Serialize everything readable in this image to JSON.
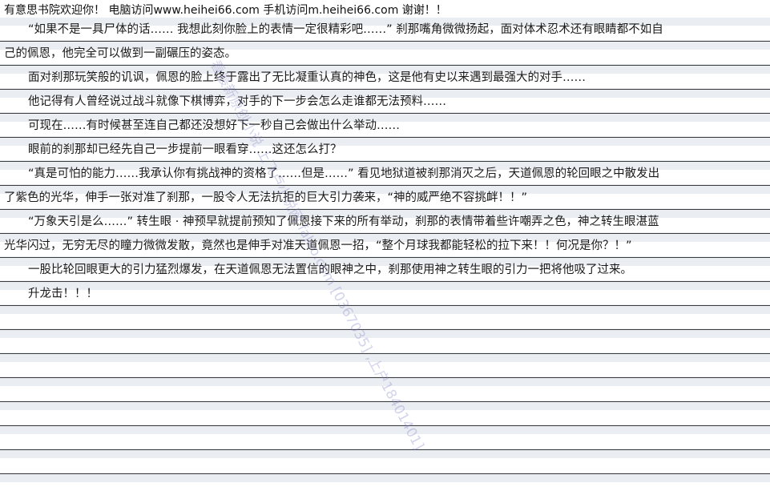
{
  "header": {
    "text": "有意思书院欢迎你！ 电脑访问www.heihei66.com  手机访问m.heihei66.com 谢谢！！"
  },
  "watermark": "看最新原创小说 上飞卢小说网 faloo.com [0367035] ,上户18401401]",
  "lines": [
    "“如果不是一具尸体的话…… 我想此刻你脸上的表情一定很精彩吧……” 刹那嘴角微微扬起，面对体术忍术还有眼睛都不如自",
    "己的佩恩，他完全可以做到一副碾压的姿态。",
    "",
    "面对刹那玩笑般的讥讽，佩恩的脸上终于露出了无比凝重认真的神色，这是他有史以来遇到最强大的对手……",
    "",
    "他记得有人曾经说过战斗就像下棋博弈，对手的下一步会怎么走谁都无法预料……",
    "",
    "可现在……有时候甚至连自己都还没想好下一秒自己会做出什么举动……",
    "",
    "眼前的刹那却已经先自己一步提前一眼看穿……这还怎么打？",
    "",
    "“真是可怕的能力……我承认你有挑战神的资格了……但是……” 看见地狱道被刹那消灭之后，天道佩恩的轮回眼之中散发出",
    "了紫色的光华，伸手一张对准了刹那，一股令人无法抗拒的巨大引力袭来，“神的威严绝不容挑衅！！”",
    "",
    "“万象天引是么……” 转生眼 · 神预早就提前预知了佩恩接下来的所有举动，刹那的表情带着些许嘲弄之色，神之转生眼湛蓝",
    "光华闪过，无穷无尽的瞳力微微发散，竟然也是伸手对准天道佩恩一招，“整个月球我都能轻松的拉下来！！何况是你？！”",
    "",
    "一股比轮回眼更大的引力猛烈爆发，在天道佩恩无法置信的眼神之中，刹那使用神之转生眼的引力一把将他吸了过来。",
    "",
    "升龙击！！！"
  ]
}
